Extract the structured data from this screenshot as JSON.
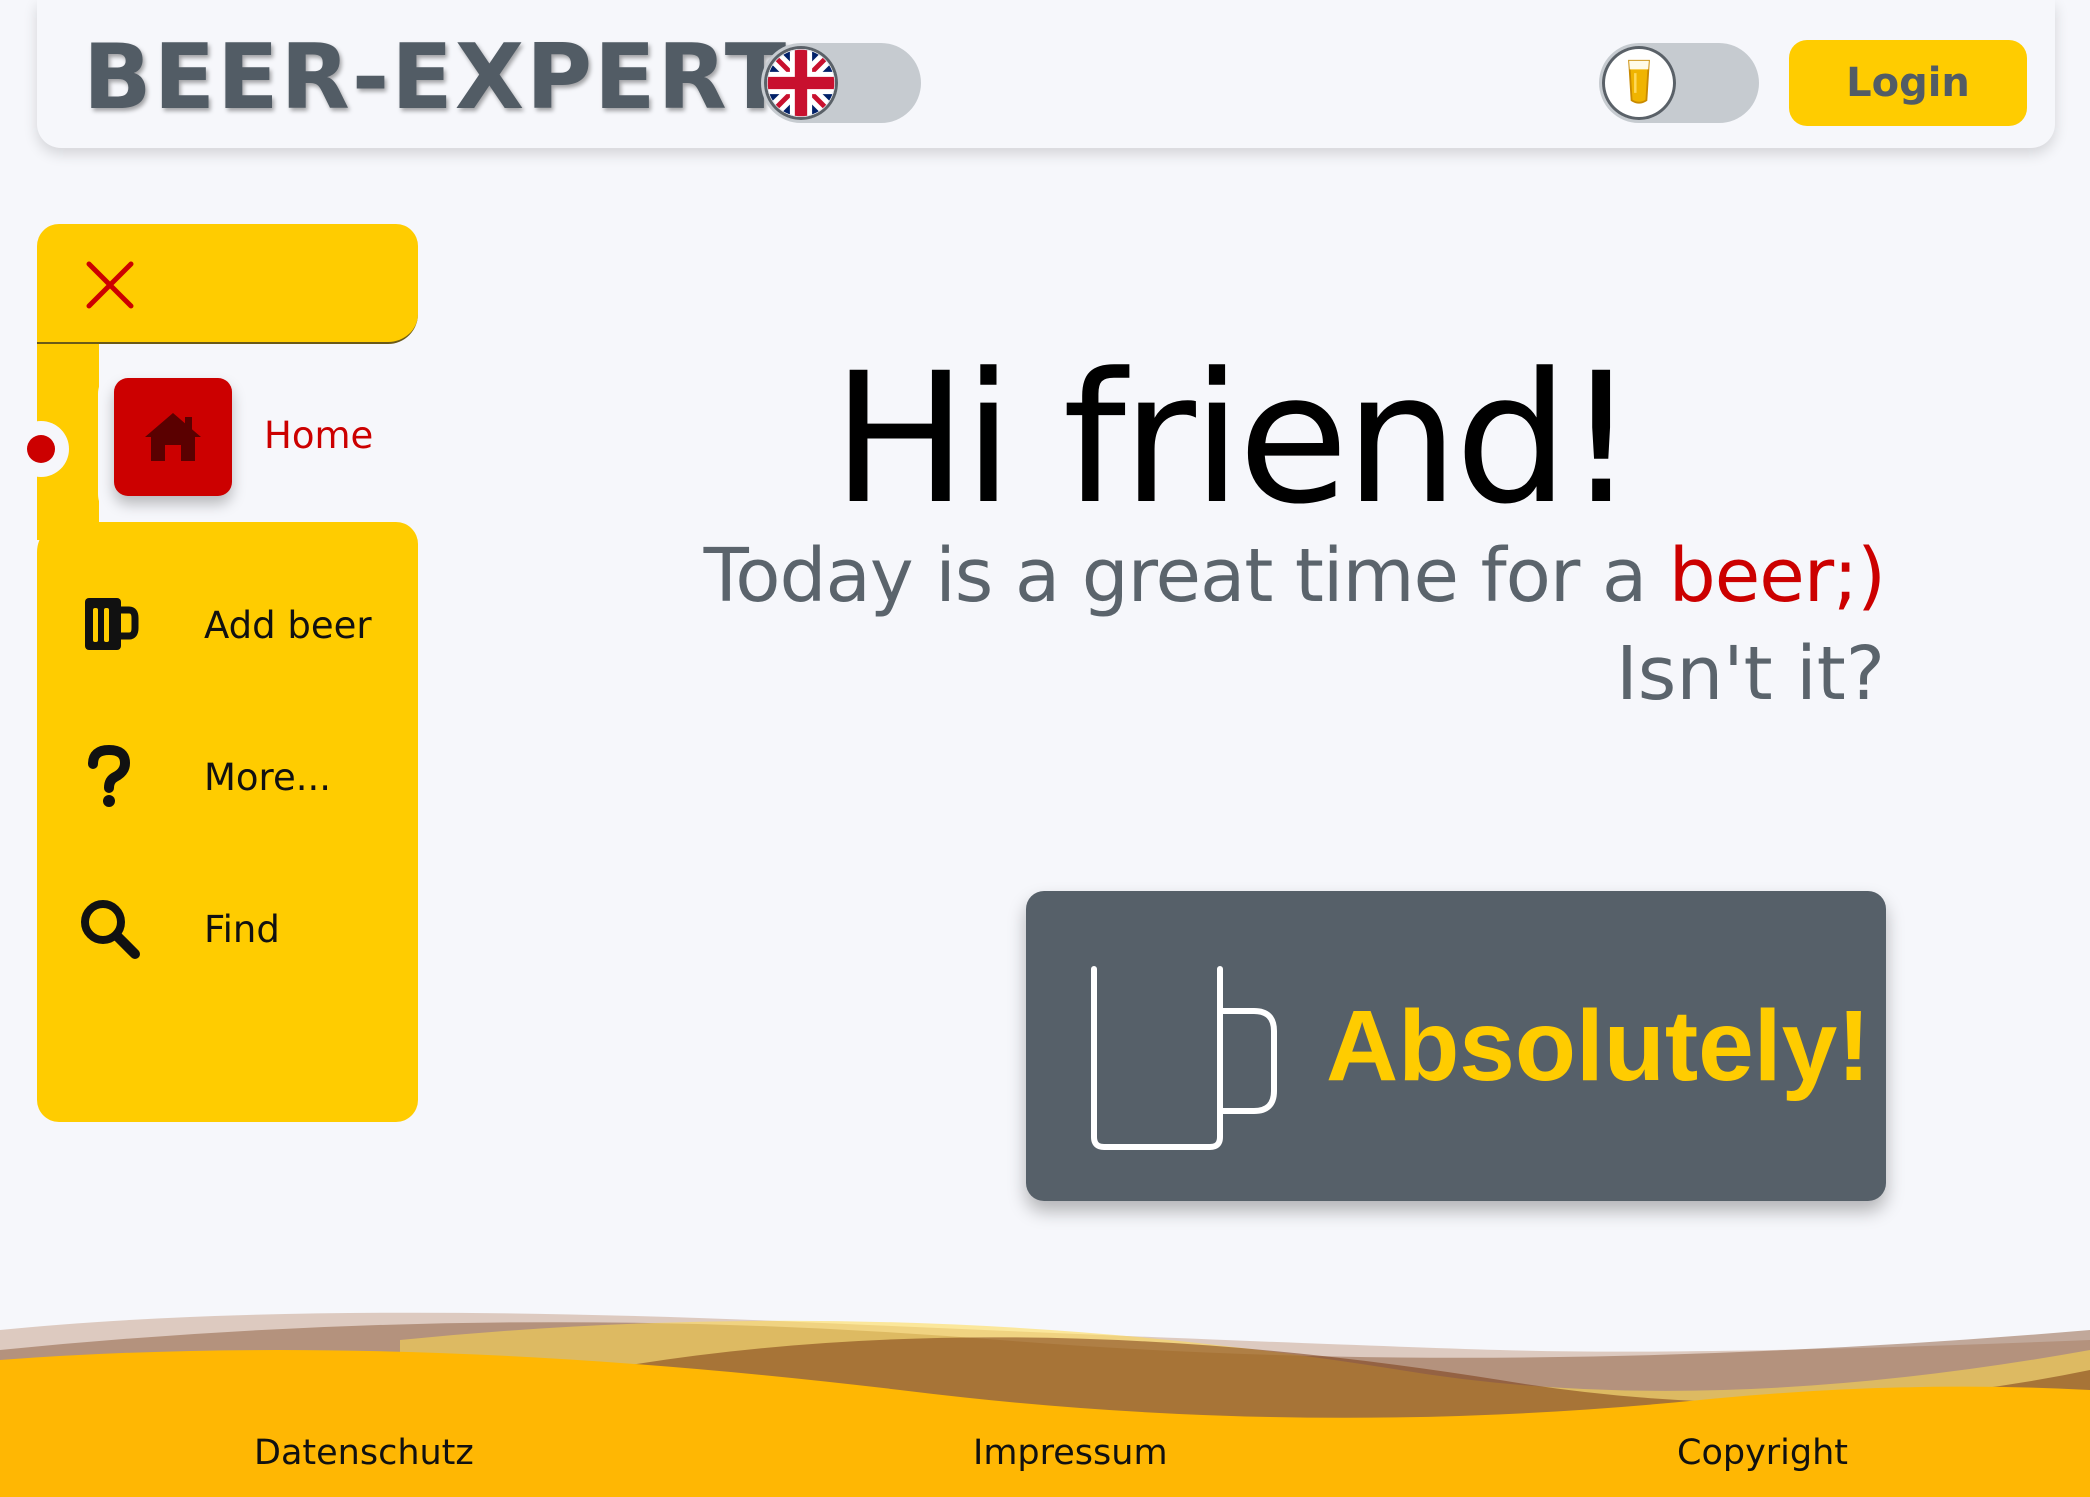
{
  "header": {
    "logo_text": "BEER-EXPERT",
    "language_toggle_icon": "uk-flag-icon",
    "theme_toggle_icon": "beer-glass-icon",
    "login_label": "Login"
  },
  "sidebar": {
    "close_icon": "close-icon",
    "items": [
      {
        "label": "Home",
        "icon": "home-icon",
        "active": true
      },
      {
        "label": "Add beer",
        "icon": "beer-mug-icon"
      },
      {
        "label": "More...",
        "icon": "question-icon"
      },
      {
        "label": "Find",
        "icon": "search-icon"
      }
    ]
  },
  "main": {
    "title": "Hi friend!",
    "subtitle_prefix": "Today is a great time for a ",
    "subtitle_accent": "beer;)",
    "subtitle_line2": "Isn't it?",
    "cta_label": "Absolutely!",
    "cta_icon": "mug-icon"
  },
  "footer": {
    "links": [
      "Datenschutz",
      "Impressum",
      "Copyright"
    ]
  },
  "colors": {
    "accent_yellow": "#ffcc00",
    "accent_red": "#cc0000",
    "slate": "#566069",
    "background": "#f6f7fb"
  }
}
